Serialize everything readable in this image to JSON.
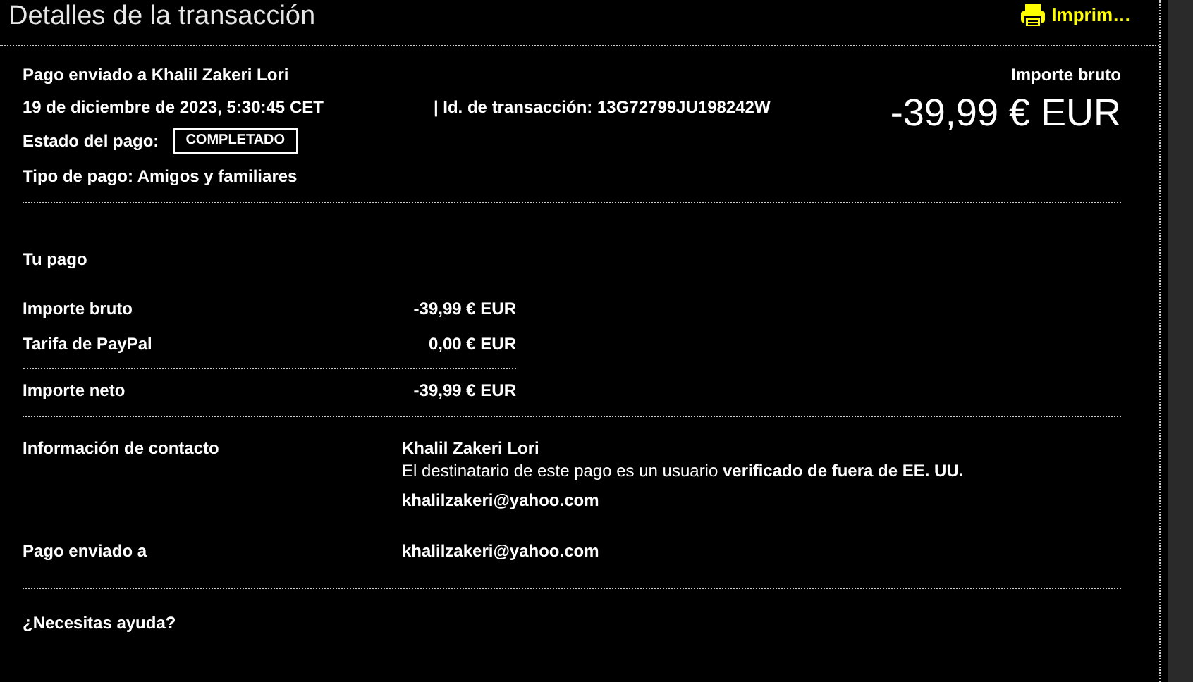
{
  "title": "Detalles de la transacción",
  "print_link": "Imprim…",
  "summary": {
    "recipient": "Pago enviado a Khalil Zakeri Lori",
    "date": "19 de diciembre de 2023, 5:30:45 CET",
    "transaction_id": "| Id. de transacción: 13G72799JU198242W",
    "status_label": "Estado del pago:",
    "status": "COMPLETADO",
    "payment_type": "Tipo de pago: Amigos y familiares",
    "amount_label": "Importe bruto",
    "amount": "-39,99 € EUR"
  },
  "your_payment": {
    "heading": "Tu pago",
    "rows": [
      {
        "label": "Importe bruto",
        "value": "-39,99 € EUR"
      },
      {
        "label": "Tarifa de PayPal",
        "value": "0,00 € EUR"
      },
      {
        "label": "Importe neto",
        "value": "-39,99 € EUR"
      }
    ]
  },
  "contact": {
    "label": "Información de contacto",
    "name": "Khalil Zakeri Lori",
    "note": "El destinatario de este pago es un usuario **verificado de fuera de EE. UU.**",
    "email": "khalilzakeri@yahoo.com"
  },
  "sent_to": {
    "label": "Pago enviado a",
    "email": "khalilzakeri@yahoo.com"
  },
  "help": "¿Necesitas ayuda?"
}
